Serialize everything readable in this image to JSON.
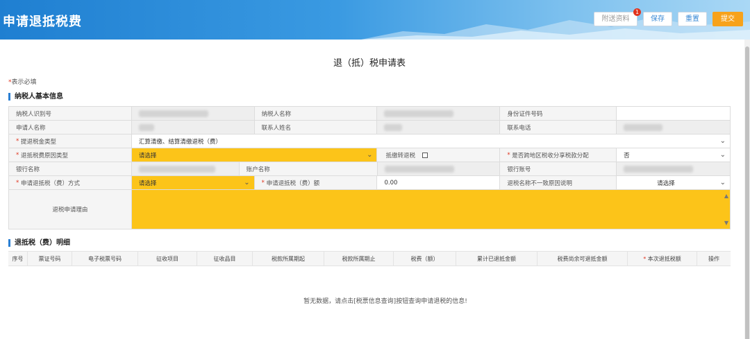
{
  "header": {
    "title": "申请退抵税费",
    "buttons": {
      "attach": "附送资料",
      "save": "保存",
      "reset": "重置",
      "submit": "提交"
    },
    "attach_badge": "1"
  },
  "form_title": "退（抵）税申请表",
  "required_note": "表示必填",
  "section_basic": "纳税人基本信息",
  "section_detail": "退抵税（费）明细",
  "rows": {
    "r1": {
      "l1": "纳税人识别号",
      "l2": "纳税人名称",
      "l3": "身份证件号码"
    },
    "r2": {
      "l1": "申请人名称",
      "l2": "联系人姓名",
      "l3": "联系电话"
    },
    "r3": {
      "l1": "提退税金类型",
      "v1": "汇算清缴、结算清缴退税（费）"
    },
    "r4": {
      "l1": "退抵税费原因类型",
      "v1": "请选择",
      "l2": "抵缴转退税",
      "l3": "是否跨地区税收分享税款分配",
      "v3": "否"
    },
    "r5": {
      "l1": "银行名称",
      "l2": "账户名称",
      "l3": "银行账号"
    },
    "r6": {
      "l1": "申请退抵税（费）方式",
      "v1": "请选择",
      "l2": "申请退抵税（费）额",
      "v2": "0.00",
      "l3": "退税名称不一致原因说明",
      "v3": "请选择"
    },
    "r7": {
      "l1": "退税申请理由"
    }
  },
  "detail_headers": [
    "序号",
    "票证号码",
    "电子税票号码",
    "征收项目",
    "征收品目",
    "税款所属期起",
    "税款所属期止",
    "税费（额）",
    "累计已退抵金额",
    "税费尚余可退抵金额",
    "本次退抵税额",
    "操作"
  ],
  "empty_message": "暂无数据，请点击[税票信息查询]按钮查询申请退税的信息!",
  "colors": {
    "header_blue": "#2a86d6",
    "submit_orange": "#f7a21b",
    "highlight_yellow": "#fcc419",
    "required_red": "#e0341e"
  }
}
